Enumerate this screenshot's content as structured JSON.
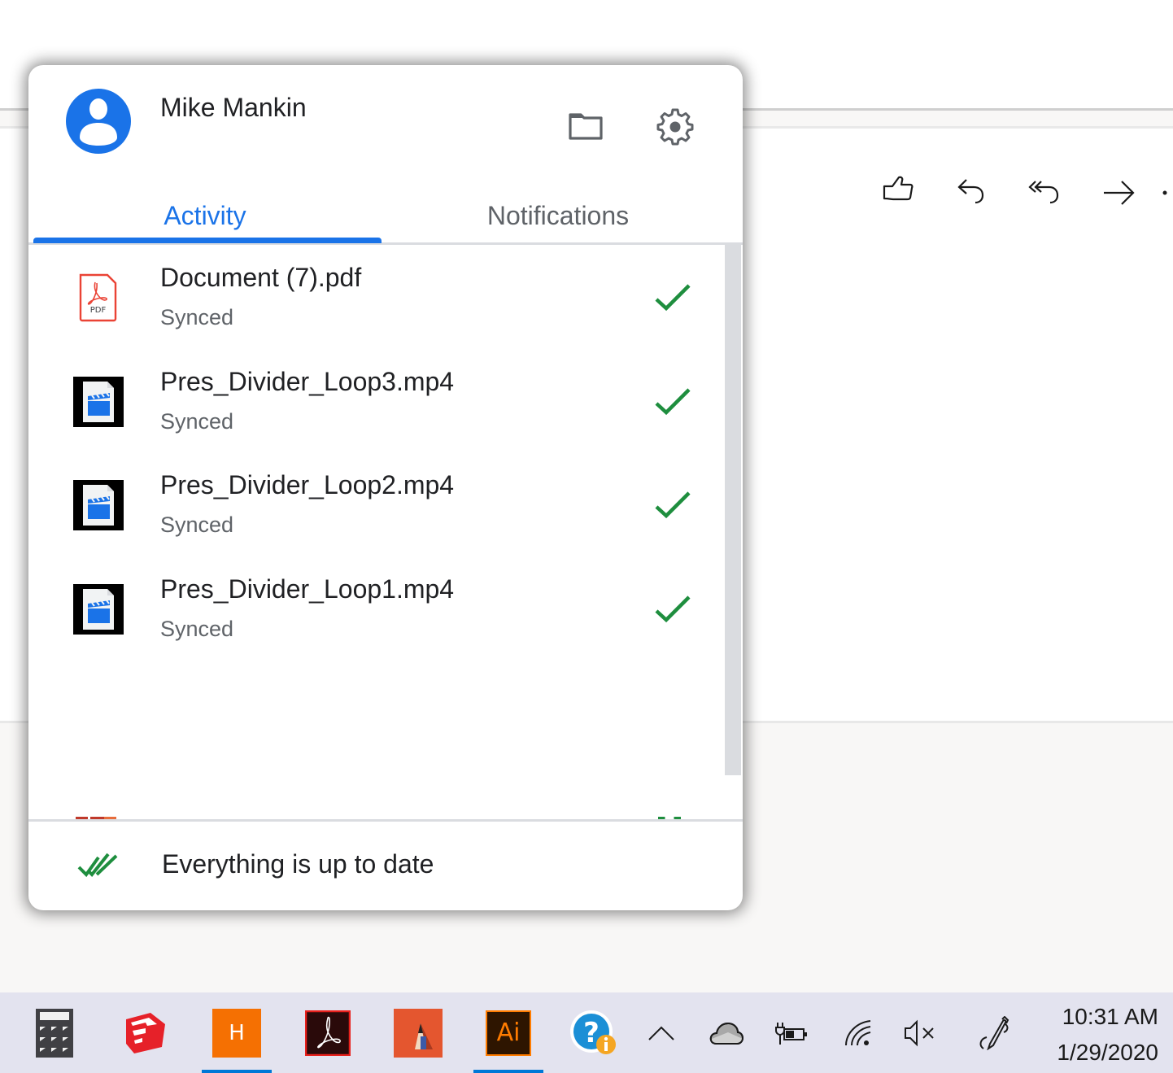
{
  "popup": {
    "user_name": "Mike Mankin",
    "header_icons": {
      "folder": "folder-icon",
      "settings": "gear-icon"
    },
    "tabs": [
      {
        "label": "Activity",
        "active": true
      },
      {
        "label": "Notifications",
        "active": false
      }
    ],
    "activity": [
      {
        "name": "Document (7).pdf",
        "status": "Synced",
        "type": "pdf"
      },
      {
        "name": "Pres_Divider_Loop3.mp4",
        "status": "Synced",
        "type": "video"
      },
      {
        "name": "Pres_Divider_Loop2.mp4",
        "status": "Synced",
        "type": "video"
      },
      {
        "name": "Pres_Divider_Loop1.mp4",
        "status": "Synced",
        "type": "video"
      }
    ],
    "footer_text": "Everything is up to date",
    "colors": {
      "accent": "#1a73e8",
      "success": "#1e8e3e",
      "pdf_red": "#ea4335"
    }
  },
  "background_app": {
    "actions": [
      "like-icon",
      "reply-icon",
      "reply-all-icon",
      "forward-icon",
      "more-icon"
    ]
  },
  "taskbar": {
    "apps": [
      {
        "name": "calculator",
        "label": "",
        "active": false
      },
      {
        "name": "sketchup",
        "label": "",
        "active": false
      },
      {
        "name": "h-app",
        "label": "H",
        "active": true
      },
      {
        "name": "acrobat",
        "label": "",
        "active": false
      },
      {
        "name": "sketchbook",
        "label": "",
        "active": false
      },
      {
        "name": "illustrator",
        "label": "Ai",
        "active": true
      },
      {
        "name": "help",
        "label": "",
        "active": false
      }
    ],
    "tray": [
      "chevron-up-icon",
      "onedrive-cloud-icon",
      "battery-charging-icon",
      "wifi-icon",
      "volume-muted-icon",
      "pen-icon"
    ],
    "time": "10:31 AM",
    "date": "1/29/2020"
  }
}
